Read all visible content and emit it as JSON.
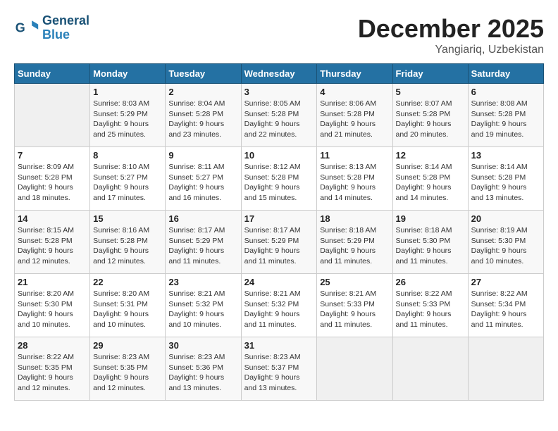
{
  "logo": {
    "general": "General",
    "blue": "Blue"
  },
  "header": {
    "month": "December 2025",
    "location": "Yangiariq, Uzbekistan"
  },
  "weekdays": [
    "Sunday",
    "Monday",
    "Tuesday",
    "Wednesday",
    "Thursday",
    "Friday",
    "Saturday"
  ],
  "weeks": [
    [
      {
        "day": null,
        "info": null
      },
      {
        "day": "1",
        "sunrise": "Sunrise: 8:03 AM",
        "sunset": "Sunset: 5:29 PM",
        "daylight": "Daylight: 9 hours and 25 minutes."
      },
      {
        "day": "2",
        "sunrise": "Sunrise: 8:04 AM",
        "sunset": "Sunset: 5:28 PM",
        "daylight": "Daylight: 9 hours and 23 minutes."
      },
      {
        "day": "3",
        "sunrise": "Sunrise: 8:05 AM",
        "sunset": "Sunset: 5:28 PM",
        "daylight": "Daylight: 9 hours and 22 minutes."
      },
      {
        "day": "4",
        "sunrise": "Sunrise: 8:06 AM",
        "sunset": "Sunset: 5:28 PM",
        "daylight": "Daylight: 9 hours and 21 minutes."
      },
      {
        "day": "5",
        "sunrise": "Sunrise: 8:07 AM",
        "sunset": "Sunset: 5:28 PM",
        "daylight": "Daylight: 9 hours and 20 minutes."
      },
      {
        "day": "6",
        "sunrise": "Sunrise: 8:08 AM",
        "sunset": "Sunset: 5:28 PM",
        "daylight": "Daylight: 9 hours and 19 minutes."
      }
    ],
    [
      {
        "day": "7",
        "sunrise": "Sunrise: 8:09 AM",
        "sunset": "Sunset: 5:28 PM",
        "daylight": "Daylight: 9 hours and 18 minutes."
      },
      {
        "day": "8",
        "sunrise": "Sunrise: 8:10 AM",
        "sunset": "Sunset: 5:27 PM",
        "daylight": "Daylight: 9 hours and 17 minutes."
      },
      {
        "day": "9",
        "sunrise": "Sunrise: 8:11 AM",
        "sunset": "Sunset: 5:27 PM",
        "daylight": "Daylight: 9 hours and 16 minutes."
      },
      {
        "day": "10",
        "sunrise": "Sunrise: 8:12 AM",
        "sunset": "Sunset: 5:28 PM",
        "daylight": "Daylight: 9 hours and 15 minutes."
      },
      {
        "day": "11",
        "sunrise": "Sunrise: 8:13 AM",
        "sunset": "Sunset: 5:28 PM",
        "daylight": "Daylight: 9 hours and 14 minutes."
      },
      {
        "day": "12",
        "sunrise": "Sunrise: 8:14 AM",
        "sunset": "Sunset: 5:28 PM",
        "daylight": "Daylight: 9 hours and 14 minutes."
      },
      {
        "day": "13",
        "sunrise": "Sunrise: 8:14 AM",
        "sunset": "Sunset: 5:28 PM",
        "daylight": "Daylight: 9 hours and 13 minutes."
      }
    ],
    [
      {
        "day": "14",
        "sunrise": "Sunrise: 8:15 AM",
        "sunset": "Sunset: 5:28 PM",
        "daylight": "Daylight: 9 hours and 12 minutes."
      },
      {
        "day": "15",
        "sunrise": "Sunrise: 8:16 AM",
        "sunset": "Sunset: 5:28 PM",
        "daylight": "Daylight: 9 hours and 12 minutes."
      },
      {
        "day": "16",
        "sunrise": "Sunrise: 8:17 AM",
        "sunset": "Sunset: 5:29 PM",
        "daylight": "Daylight: 9 hours and 11 minutes."
      },
      {
        "day": "17",
        "sunrise": "Sunrise: 8:17 AM",
        "sunset": "Sunset: 5:29 PM",
        "daylight": "Daylight: 9 hours and 11 minutes."
      },
      {
        "day": "18",
        "sunrise": "Sunrise: 8:18 AM",
        "sunset": "Sunset: 5:29 PM",
        "daylight": "Daylight: 9 hours and 11 minutes."
      },
      {
        "day": "19",
        "sunrise": "Sunrise: 8:18 AM",
        "sunset": "Sunset: 5:30 PM",
        "daylight": "Daylight: 9 hours and 11 minutes."
      },
      {
        "day": "20",
        "sunrise": "Sunrise: 8:19 AM",
        "sunset": "Sunset: 5:30 PM",
        "daylight": "Daylight: 9 hours and 10 minutes."
      }
    ],
    [
      {
        "day": "21",
        "sunrise": "Sunrise: 8:20 AM",
        "sunset": "Sunset: 5:30 PM",
        "daylight": "Daylight: 9 hours and 10 minutes."
      },
      {
        "day": "22",
        "sunrise": "Sunrise: 8:20 AM",
        "sunset": "Sunset: 5:31 PM",
        "daylight": "Daylight: 9 hours and 10 minutes."
      },
      {
        "day": "23",
        "sunrise": "Sunrise: 8:21 AM",
        "sunset": "Sunset: 5:32 PM",
        "daylight": "Daylight: 9 hours and 10 minutes."
      },
      {
        "day": "24",
        "sunrise": "Sunrise: 8:21 AM",
        "sunset": "Sunset: 5:32 PM",
        "daylight": "Daylight: 9 hours and 11 minutes."
      },
      {
        "day": "25",
        "sunrise": "Sunrise: 8:21 AM",
        "sunset": "Sunset: 5:33 PM",
        "daylight": "Daylight: 9 hours and 11 minutes."
      },
      {
        "day": "26",
        "sunrise": "Sunrise: 8:22 AM",
        "sunset": "Sunset: 5:33 PM",
        "daylight": "Daylight: 9 hours and 11 minutes."
      },
      {
        "day": "27",
        "sunrise": "Sunrise: 8:22 AM",
        "sunset": "Sunset: 5:34 PM",
        "daylight": "Daylight: 9 hours and 11 minutes."
      }
    ],
    [
      {
        "day": "28",
        "sunrise": "Sunrise: 8:22 AM",
        "sunset": "Sunset: 5:35 PM",
        "daylight": "Daylight: 9 hours and 12 minutes."
      },
      {
        "day": "29",
        "sunrise": "Sunrise: 8:23 AM",
        "sunset": "Sunset: 5:35 PM",
        "daylight": "Daylight: 9 hours and 12 minutes."
      },
      {
        "day": "30",
        "sunrise": "Sunrise: 8:23 AM",
        "sunset": "Sunset: 5:36 PM",
        "daylight": "Daylight: 9 hours and 13 minutes."
      },
      {
        "day": "31",
        "sunrise": "Sunrise: 8:23 AM",
        "sunset": "Sunset: 5:37 PM",
        "daylight": "Daylight: 9 hours and 13 minutes."
      },
      {
        "day": null,
        "info": null
      },
      {
        "day": null,
        "info": null
      },
      {
        "day": null,
        "info": null
      }
    ]
  ]
}
